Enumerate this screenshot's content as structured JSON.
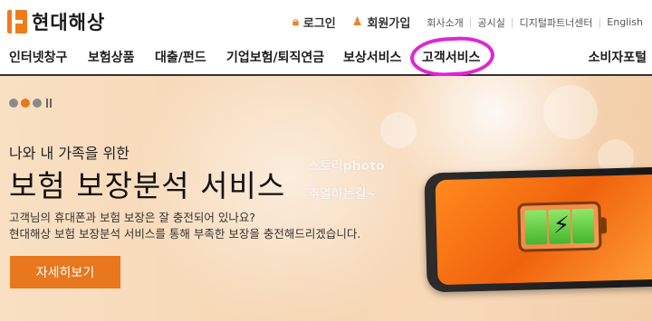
{
  "brand": {
    "name": "현대해상"
  },
  "util": {
    "login": "로그인",
    "join": "회원가입",
    "links": [
      "회사소개",
      "공시실",
      "디지털파트너센터",
      "English"
    ]
  },
  "nav": {
    "items": [
      "인터넷창구",
      "보험상품",
      "대출/펀드",
      "기업보험/퇴직연금",
      "보상서비스",
      "고객서비스"
    ],
    "right": "소비자포털"
  },
  "hero": {
    "subtitle": "나와 내 가족을 위한",
    "title": "보험 보장분석 서비스",
    "desc_line1": "고객님의 휴대폰과 보험 보장은 잘 충전되어 있나요?",
    "desc_line2": "현대해상 보험 보장분석 서비스를 통해 부족한 보장을 충전해드리겠습니다.",
    "button": "자세히보기",
    "watermark_line1": "스토리photo",
    "watermark_line2": "추열하는길~♡",
    "slider": {
      "total": 3,
      "current": 1
    }
  },
  "colors": {
    "accent": "#e8771e",
    "highlight": "#e024d6"
  }
}
